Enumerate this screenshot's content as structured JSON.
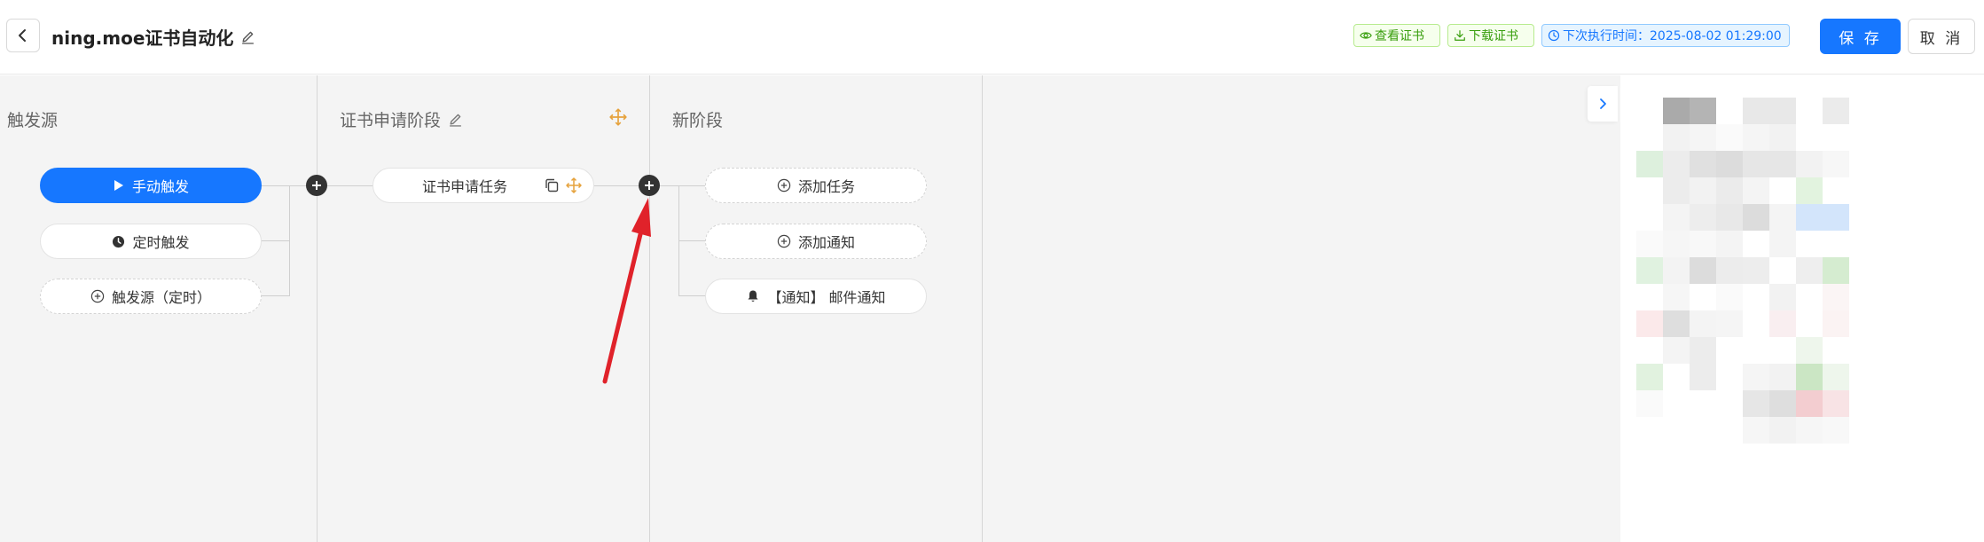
{
  "header": {
    "title": "ning.moe证书自动化",
    "tags": {
      "view_cert": "查看证书",
      "download_cert": "下载证书",
      "next_run": "下次执行时间：2025-08-02 01:29:00"
    },
    "save_label": "保 存",
    "cancel_label": "取 消"
  },
  "colors": {
    "primary": "#1677ff",
    "success_tag": "#389e0d",
    "canvas_bg": "#f4f4f4",
    "move_icon": "#e6a23c",
    "arrow": "#e0222a"
  },
  "stages": {
    "trigger": {
      "title": "触发源",
      "nodes": {
        "manual": "手动触发",
        "timer": "定时触发",
        "add": "触发源（定时）"
      }
    },
    "cert_apply": {
      "title": "证书申请阶段",
      "task": "证书申请任务"
    },
    "new_stage": {
      "title": "新阶段",
      "add_task": "添加任务",
      "add_notify": "添加通知",
      "notify_item": "【通知】 邮件通知"
    }
  },
  "icons": {
    "back": "chevron-left-icon",
    "edit": "pencil-icon",
    "eye": "eye-icon",
    "download": "download-icon",
    "clock": "clock-icon",
    "play": "play-icon",
    "plus_circle": "plus-circle-icon",
    "copy": "copy-icon",
    "move": "move-icon",
    "bell": "bell-icon",
    "expand": "chevron-right-icon"
  }
}
